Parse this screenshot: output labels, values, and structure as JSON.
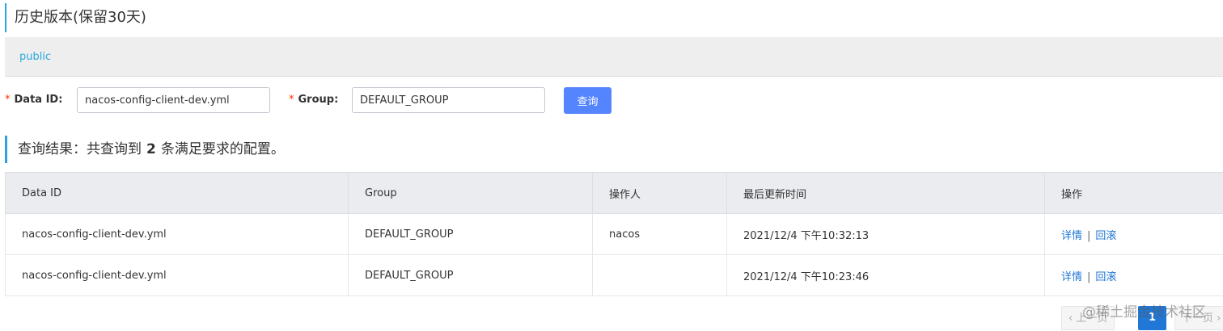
{
  "header": {
    "title": "历史版本(保留30天)"
  },
  "namespace": {
    "items": [
      "public"
    ]
  },
  "search": {
    "data_id_label": "Data ID:",
    "data_id_value": "nacos-config-client-dev.yml",
    "group_label": "Group:",
    "group_value": "DEFAULT_GROUP",
    "query_button": "查询",
    "required_mark": "*"
  },
  "result": {
    "prefix": "查询结果：共查询到",
    "count": "2",
    "suffix": "条满足要求的配置。"
  },
  "table": {
    "columns": [
      "Data ID",
      "Group",
      "操作人",
      "最后更新时间",
      "操作"
    ],
    "rows": [
      {
        "data_id": "nacos-config-client-dev.yml",
        "group": "DEFAULT_GROUP",
        "operator": "nacos",
        "updated": "2021/12/4 下午10:32:13"
      },
      {
        "data_id": "nacos-config-client-dev.yml",
        "group": "DEFAULT_GROUP",
        "operator": "",
        "updated": "2021/12/4 下午10:23:46"
      }
    ],
    "actions": {
      "detail": "详情",
      "separator": "|",
      "rollback": "回滚"
    }
  },
  "pagination": {
    "prev": "上一页",
    "current": "1",
    "next": "下一页"
  },
  "watermark": "@稀土掘金技术社区",
  "colors": {
    "accent": "#2aa2de",
    "primary_button": "#5584ff",
    "link": "#2077d6",
    "required": "#ff3000"
  }
}
